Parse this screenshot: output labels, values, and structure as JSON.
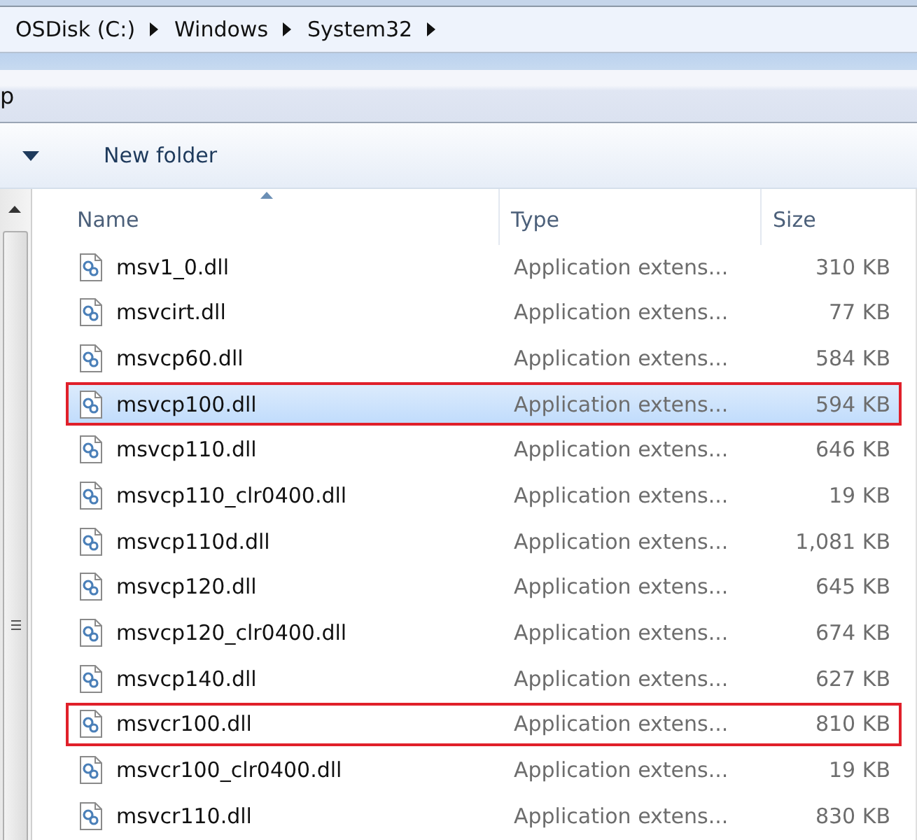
{
  "breadcrumb": [
    {
      "label": "OSDisk (C:)"
    },
    {
      "label": "Windows"
    },
    {
      "label": "System32"
    }
  ],
  "menu_bar": {
    "text": "p"
  },
  "toolbar": {
    "buttons": [
      {
        "label": "New folder"
      }
    ]
  },
  "table": {
    "columns": [
      {
        "label": "Name",
        "sorted": true
      },
      {
        "label": "Type",
        "sorted": false
      },
      {
        "label": "Size",
        "sorted": false
      }
    ],
    "rows": [
      {
        "name": "msv1_0.dll",
        "type": "Application extens...",
        "size": "310 KB",
        "selected": false,
        "highlighted": false
      },
      {
        "name": "msvcirt.dll",
        "type": "Application extens...",
        "size": "77 KB",
        "selected": false,
        "highlighted": false
      },
      {
        "name": "msvcp60.dll",
        "type": "Application extens...",
        "size": "584 KB",
        "selected": false,
        "highlighted": false
      },
      {
        "name": "msvcp100.dll",
        "type": "Application extens...",
        "size": "594 KB",
        "selected": true,
        "highlighted": true
      },
      {
        "name": "msvcp110.dll",
        "type": "Application extens...",
        "size": "646 KB",
        "selected": false,
        "highlighted": false
      },
      {
        "name": "msvcp110_clr0400.dll",
        "type": "Application extens...",
        "size": "19 KB",
        "selected": false,
        "highlighted": false
      },
      {
        "name": "msvcp110d.dll",
        "type": "Application extens...",
        "size": "1,081 KB",
        "selected": false,
        "highlighted": false
      },
      {
        "name": "msvcp120.dll",
        "type": "Application extens...",
        "size": "645 KB",
        "selected": false,
        "highlighted": false
      },
      {
        "name": "msvcp120_clr0400.dll",
        "type": "Application extens...",
        "size": "674 KB",
        "selected": false,
        "highlighted": false
      },
      {
        "name": "msvcp140.dll",
        "type": "Application extens...",
        "size": "627 KB",
        "selected": false,
        "highlighted": false
      },
      {
        "name": "msvcr100.dll",
        "type": "Application extens...",
        "size": "810 KB",
        "selected": false,
        "highlighted": true
      },
      {
        "name": "msvcr100_clr0400.dll",
        "type": "Application extens...",
        "size": "19 KB",
        "selected": false,
        "highlighted": false
      },
      {
        "name": "msvcr110.dll",
        "type": "Application extens...",
        "size": "830 KB",
        "selected": false,
        "highlighted": false
      }
    ]
  }
}
